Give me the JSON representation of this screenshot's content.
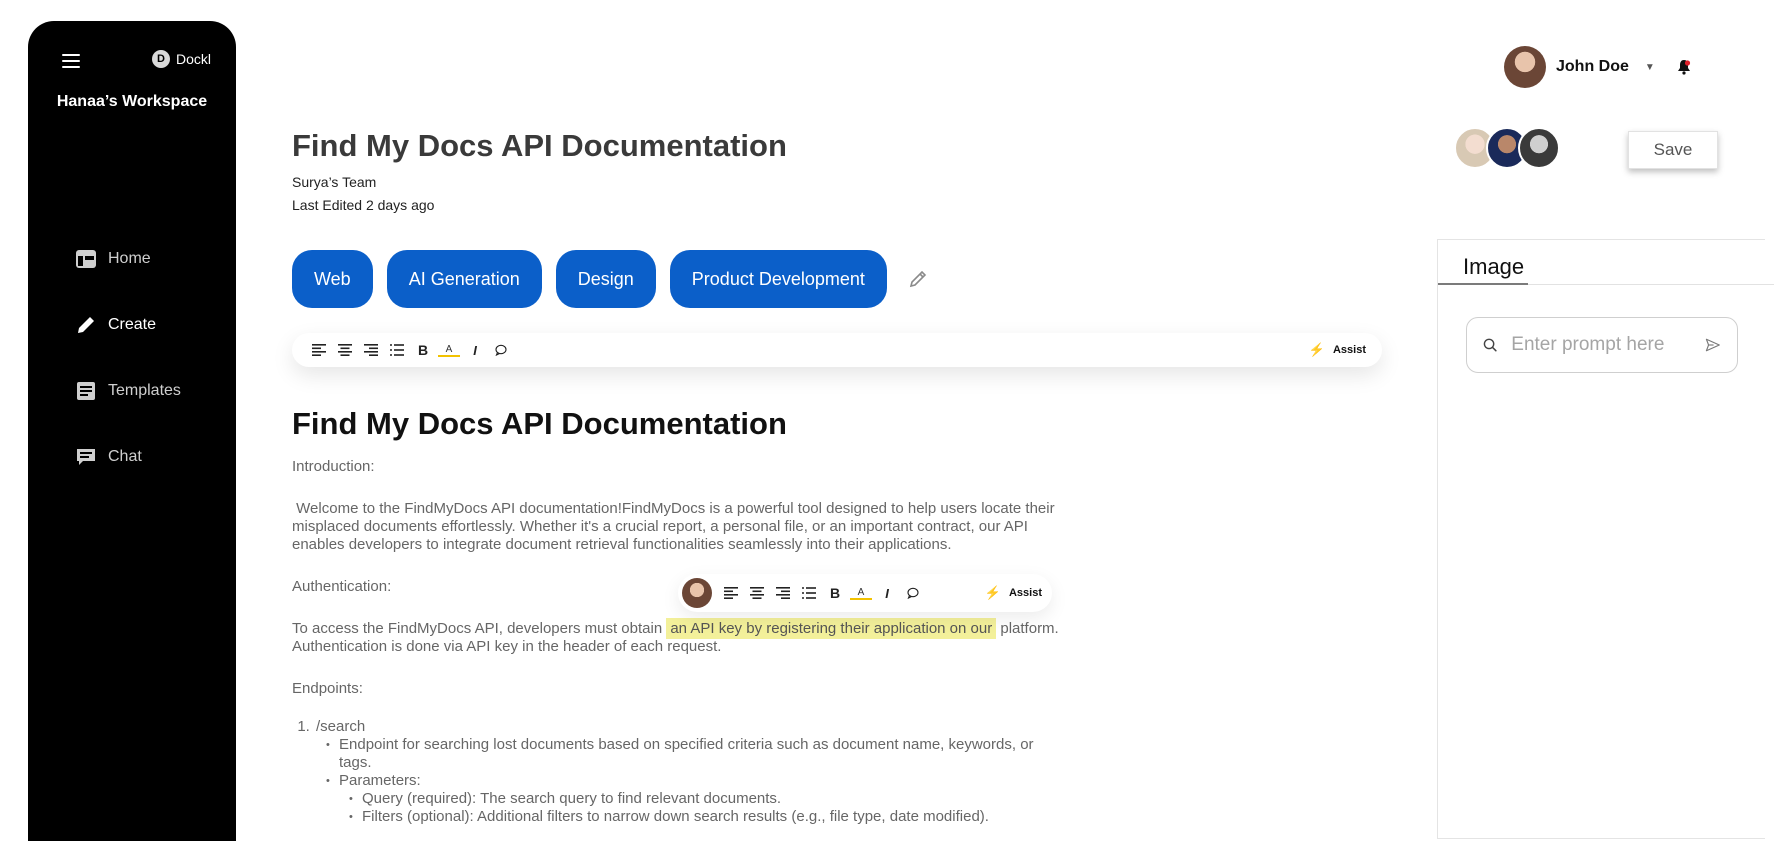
{
  "sidebar": {
    "brand": "Dockl",
    "brand_logo": "D",
    "workspace": "Hanaa’s Workspace",
    "items": [
      {
        "label": "Home",
        "icon": "home-icon"
      },
      {
        "label": "Create",
        "icon": "pencil-icon",
        "active": true
      },
      {
        "label": "Templates",
        "icon": "templates-icon"
      },
      {
        "label": "Chat",
        "icon": "chat-icon"
      }
    ]
  },
  "header": {
    "user_name": "John Doe",
    "save_label": "Save"
  },
  "document": {
    "title": "Find My Docs API Documentation",
    "team": "Surya’s Team",
    "last_edited": "Last Edited 2 days ago",
    "tags": [
      "Web",
      "AI Generation",
      "Design",
      "Product Development"
    ],
    "heading": "Find My Docs API Documentation",
    "intro_label": "Introduction:",
    "intro_text": " Welcome to the FindMyDocs API documentation!FindMyDocs is a powerful tool designed to help users locate their misplaced documents effortlessly. Whether it's a crucial report, a personal file, or an important contract, our API enables developers to integrate document retrieval functionalities seamlessly into their applications.",
    "auth_label": "Authentication:",
    "auth_text_before": "To access the FindMyDocs API, developers must obtain ",
    "auth_highlight": "an API key by registering their application on our",
    "auth_text_after": " platform. Authentication is done via API key in the header of each request.",
    "endpoints_label": "Endpoints:",
    "endpoint_1": "/search",
    "endpoint_1_desc": "Endpoint for searching lost documents based on specified criteria such as document name, keywords, or tags.",
    "params_label": "Parameters:",
    "param_query": "Query (required): The search query to find relevant documents.",
    "param_filters": "Filters (optional): Additional filters to narrow down search results (e.g., file type, date modified)."
  },
  "toolbar": {
    "assist_label": "Assist"
  },
  "panel": {
    "tab_label": "Image",
    "prompt_placeholder": "Enter prompt here"
  },
  "colors": {
    "accent": "#0b5fc9",
    "highlight": "#f3f09a",
    "sidebar_bg": "#000000"
  }
}
